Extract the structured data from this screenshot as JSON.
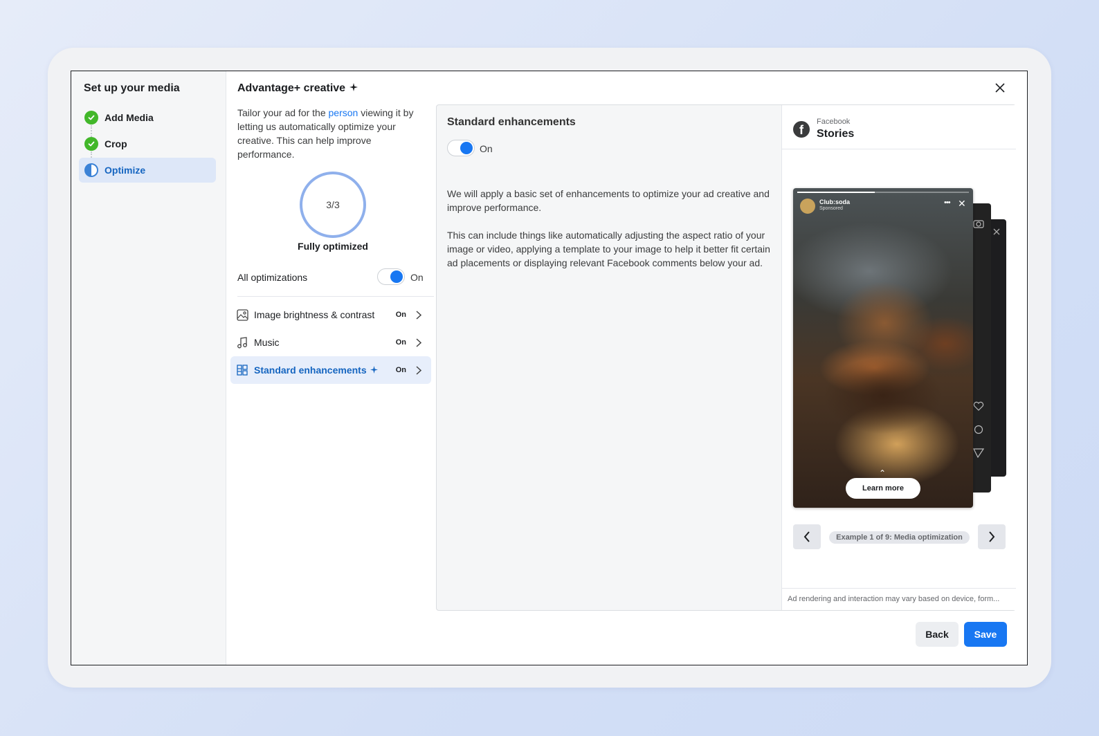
{
  "rail": {
    "title": "Set up your media",
    "steps": [
      {
        "label": "Add Media",
        "state": "done"
      },
      {
        "label": "Crop",
        "state": "done"
      },
      {
        "label": "Optimize",
        "state": "current"
      }
    ]
  },
  "main": {
    "title": "Advantage+ creative",
    "description_before_link": "Tailor your ad for the ",
    "description_link": "person",
    "description_after_link": " viewing it by letting us automatically optimize your creative. This can help improve performance.",
    "score": "3/3",
    "score_caption": "Fully optimized",
    "all_optimizations_label": "All optimizations",
    "all_optimizations_state": "On",
    "options": [
      {
        "label": "Image brightness & contrast",
        "state": "On",
        "icon": "image-icon"
      },
      {
        "label": "Music",
        "state": "On",
        "icon": "music-note-icon"
      },
      {
        "label": "Standard enhancements",
        "state": "On",
        "icon": "grid-icon",
        "selected": true
      }
    ]
  },
  "detail": {
    "title": "Standard enhancements",
    "toggle_state": "On",
    "paragraph1": "We will apply a basic set of enhancements to optimize your ad creative and improve performance.",
    "paragraph2": "This can include things like automatically adjusting the aspect ratio of your image or video, applying a template to your image to help it better fit certain ad placements or displaying relevant Facebook comments below your ad."
  },
  "preview": {
    "platform": "Facebook",
    "placement": "Stories",
    "story": {
      "account_name": "Club:soda",
      "sponsored_label": "Sponsored",
      "cta_label": "Learn more",
      "progress": 0.45
    },
    "example_label": "Example 1 of 9: Media optimization",
    "footer_note": "Ad rendering and interaction may vary based on device, form..."
  },
  "footer": {
    "back_label": "Back",
    "save_label": "Save"
  },
  "colors": {
    "accent": "#1877f2",
    "success": "#42b72a",
    "selected_bg": "#e7eefb"
  }
}
